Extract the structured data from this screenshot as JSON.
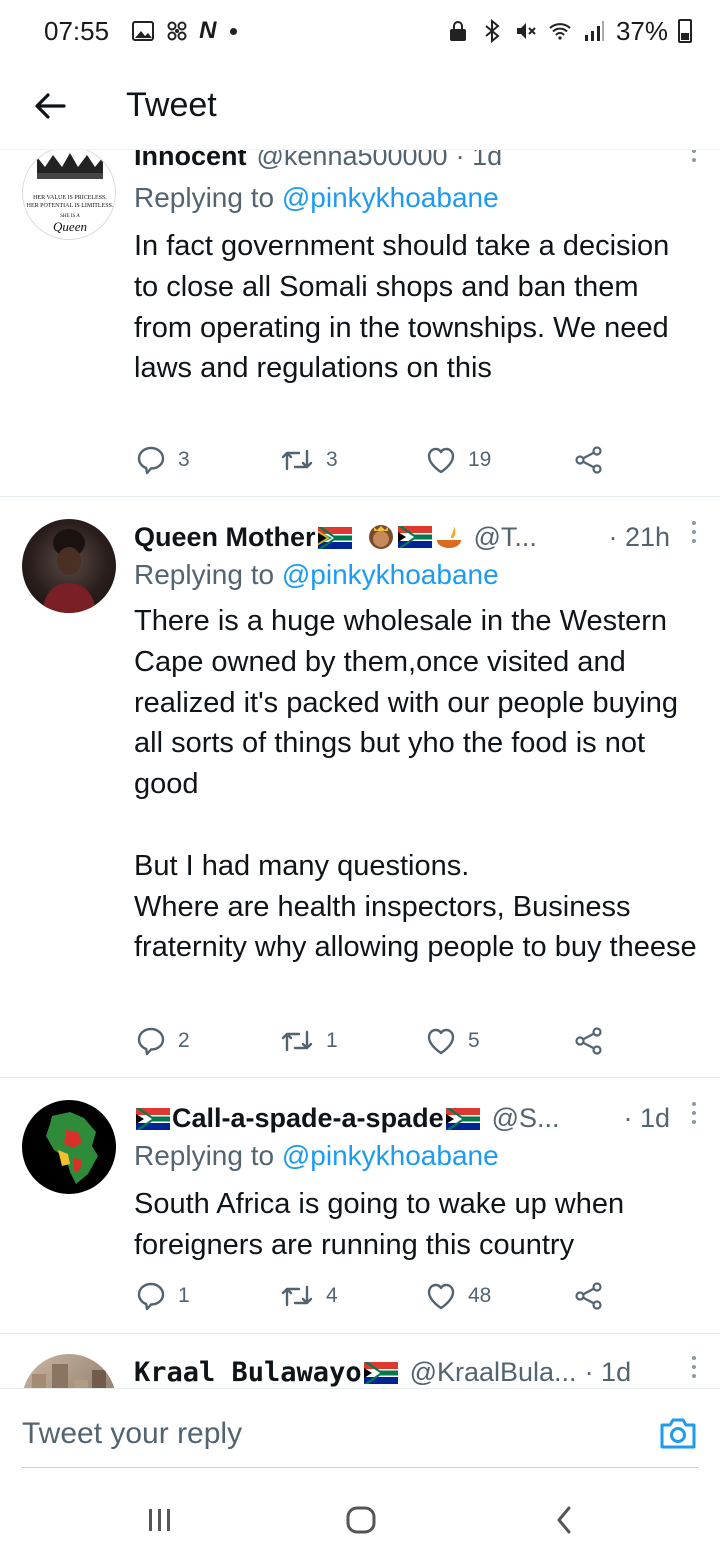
{
  "status": {
    "time": "07:55",
    "battery": "37%"
  },
  "header": {
    "title": "Tweet"
  },
  "tweets": [
    {
      "name": "Innocent",
      "handle": "@kenna500000",
      "time": "· 1d",
      "replying_label": "Replying to",
      "replying_to": "@pinkykhoabane",
      "text": "In fact government should take a decision to close all Somali shops and ban them from operating in the townships. We need laws and regulations on this",
      "replies": "3",
      "retweets": "3",
      "likes": "19",
      "avatar_text": {
        "line1": "HER VALUE IS PRICELESS.",
        "line2": "HER POTENTIAL IS LIMITLESS.",
        "line3": "SHE IS A",
        "line4": "Queen"
      }
    },
    {
      "name": "Queen Mother",
      "handle": "@T...",
      "time": "· 21h",
      "replying_label": "Replying to",
      "replying_to": "@pinkykhoabane",
      "text": "There is a huge wholesale in the Western Cape owned by them,once visited and realized it's packed with our people buying all sorts of things but yho the food is not good\n\nBut I had many questions.\nWhere are health inspectors, Business fraternity why allowing people to buy theese",
      "replies": "2",
      "retweets": "1",
      "likes": "5"
    },
    {
      "name": "Call-a-spade-a-spade",
      "handle": "@S...",
      "time": "· 1d",
      "replying_label": "Replying to",
      "replying_to": "@pinkykhoabane",
      "text": "South Africa is going to wake up when foreigners are running this country",
      "replies": "1",
      "retweets": "4",
      "likes": "48"
    },
    {
      "name": "Kraal Bulawayo",
      "handle": "@KraalBula...",
      "time": "· 1d"
    }
  ],
  "composer": {
    "placeholder": "Tweet your reply"
  },
  "colors": {
    "link": "#1d9bf0",
    "muted": "#536471",
    "text": "#0f1419"
  }
}
